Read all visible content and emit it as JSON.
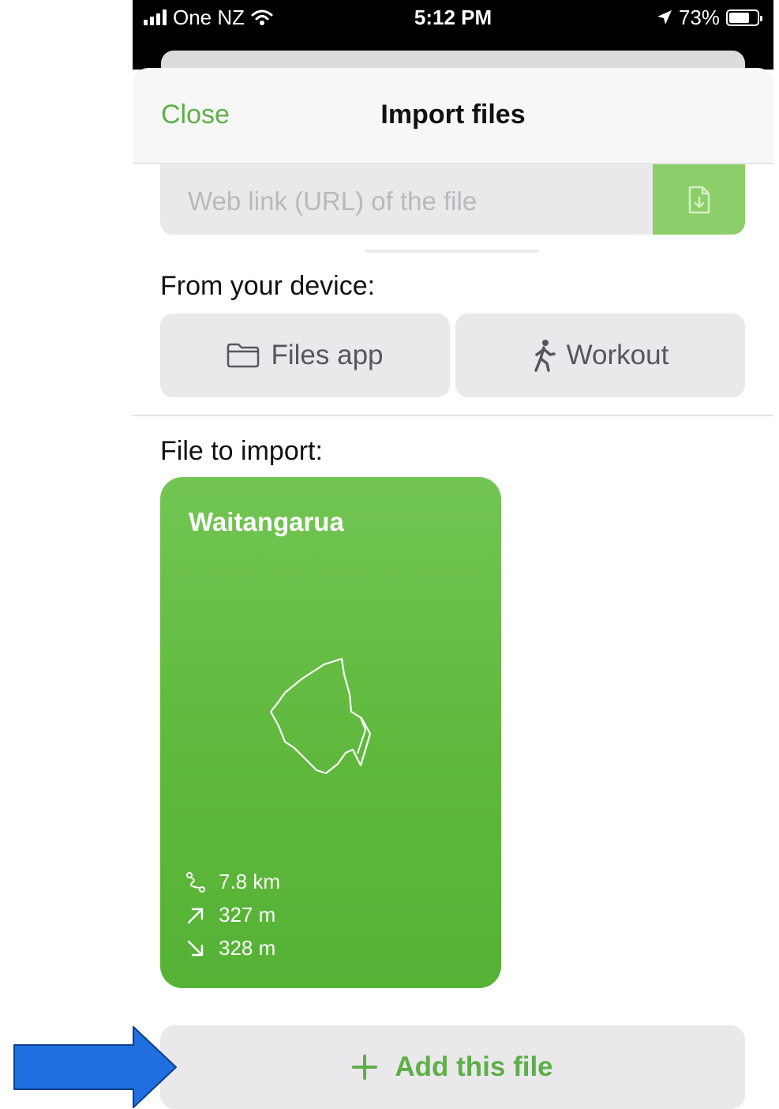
{
  "status_bar": {
    "carrier": "One NZ",
    "time": "5:12 PM",
    "battery": "73%",
    "battery_level": 0.73,
    "icons": [
      "signal-icon",
      "wifi-icon",
      "location-arrow-icon",
      "battery-icon"
    ]
  },
  "header": {
    "close_label": "Close",
    "title": "Import files"
  },
  "url_field": {
    "placeholder": "Web link (URL) of the file",
    "value": "",
    "button_icon": "download-file-icon"
  },
  "device_section": {
    "label": "From your device:",
    "buttons": [
      {
        "label": "Files app",
        "icon": "folder-icon"
      },
      {
        "label": "Workout",
        "icon": "walking-person-icon"
      }
    ]
  },
  "import_section": {
    "label": "File to import:",
    "card": {
      "title": "Waitangarua",
      "distance": "7.8 km",
      "ascent": "327 m",
      "descent": "328 m",
      "icons": [
        "route-shape-icon",
        "distance-icon",
        "ascent-arrow-icon",
        "descent-arrow-icon"
      ]
    }
  },
  "add_button": {
    "label": "Add this file",
    "icon": "plus-icon"
  },
  "annotation": {
    "icon": "pointer-arrow-icon"
  },
  "colors": {
    "accent_green": "#5fae49",
    "card_green": "#5fb83c",
    "annotation_blue": "#1f6fe0"
  }
}
